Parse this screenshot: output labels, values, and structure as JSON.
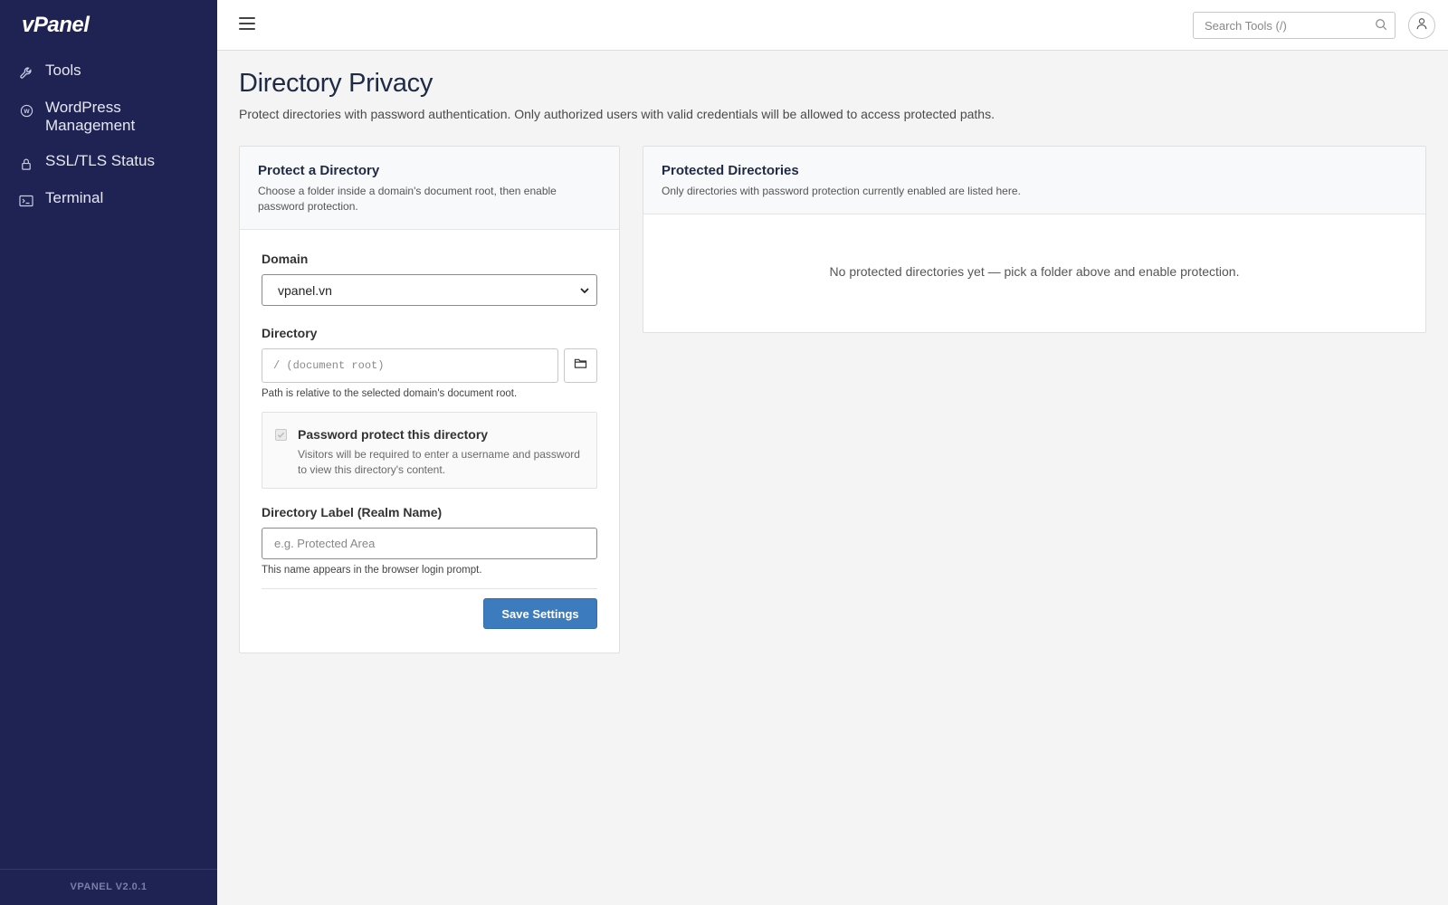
{
  "sidebar": {
    "logo": "vPanel",
    "items": [
      {
        "label": "Tools",
        "icon": "wrench-icon"
      },
      {
        "label": "WordPress\nManagement",
        "icon": "wordpress-icon"
      },
      {
        "label": "SSL/TLS Status",
        "icon": "lock-icon"
      },
      {
        "label": "Terminal",
        "icon": "terminal-icon"
      }
    ],
    "version": "VPANEL V2.0.1"
  },
  "topbar": {
    "search_placeholder": "Search Tools (/)"
  },
  "page": {
    "title": "Directory Privacy",
    "description": "Protect directories with password authentication. Only authorized users with valid credentials will be allowed to access protected paths."
  },
  "protect_card": {
    "title": "Protect a Directory",
    "subtitle": "Choose a folder inside a domain's document root, then enable password protection.",
    "domain_label": "Domain",
    "domain_value": "vpanel.vn",
    "directory_label": "Directory",
    "directory_placeholder": "/ (document root)",
    "directory_help": "Path is relative to the selected domain's document root.",
    "protect_title": "Password protect this directory",
    "protect_desc": "Visitors will be required to enter a username and password to view this directory's content.",
    "protect_checked": true,
    "realm_label": "Directory Label (Realm Name)",
    "realm_placeholder": "e.g. Protected Area",
    "realm_help": "This name appears in the browser login prompt.",
    "save_label": "Save Settings"
  },
  "protected_card": {
    "title": "Protected Directories",
    "subtitle": "Only directories with password protection currently enabled are listed here.",
    "empty_message": "No protected directories yet — pick a folder above and enable protection."
  },
  "colors": {
    "sidebar_bg": "#1f2354",
    "accent": "#3c7cbe"
  }
}
